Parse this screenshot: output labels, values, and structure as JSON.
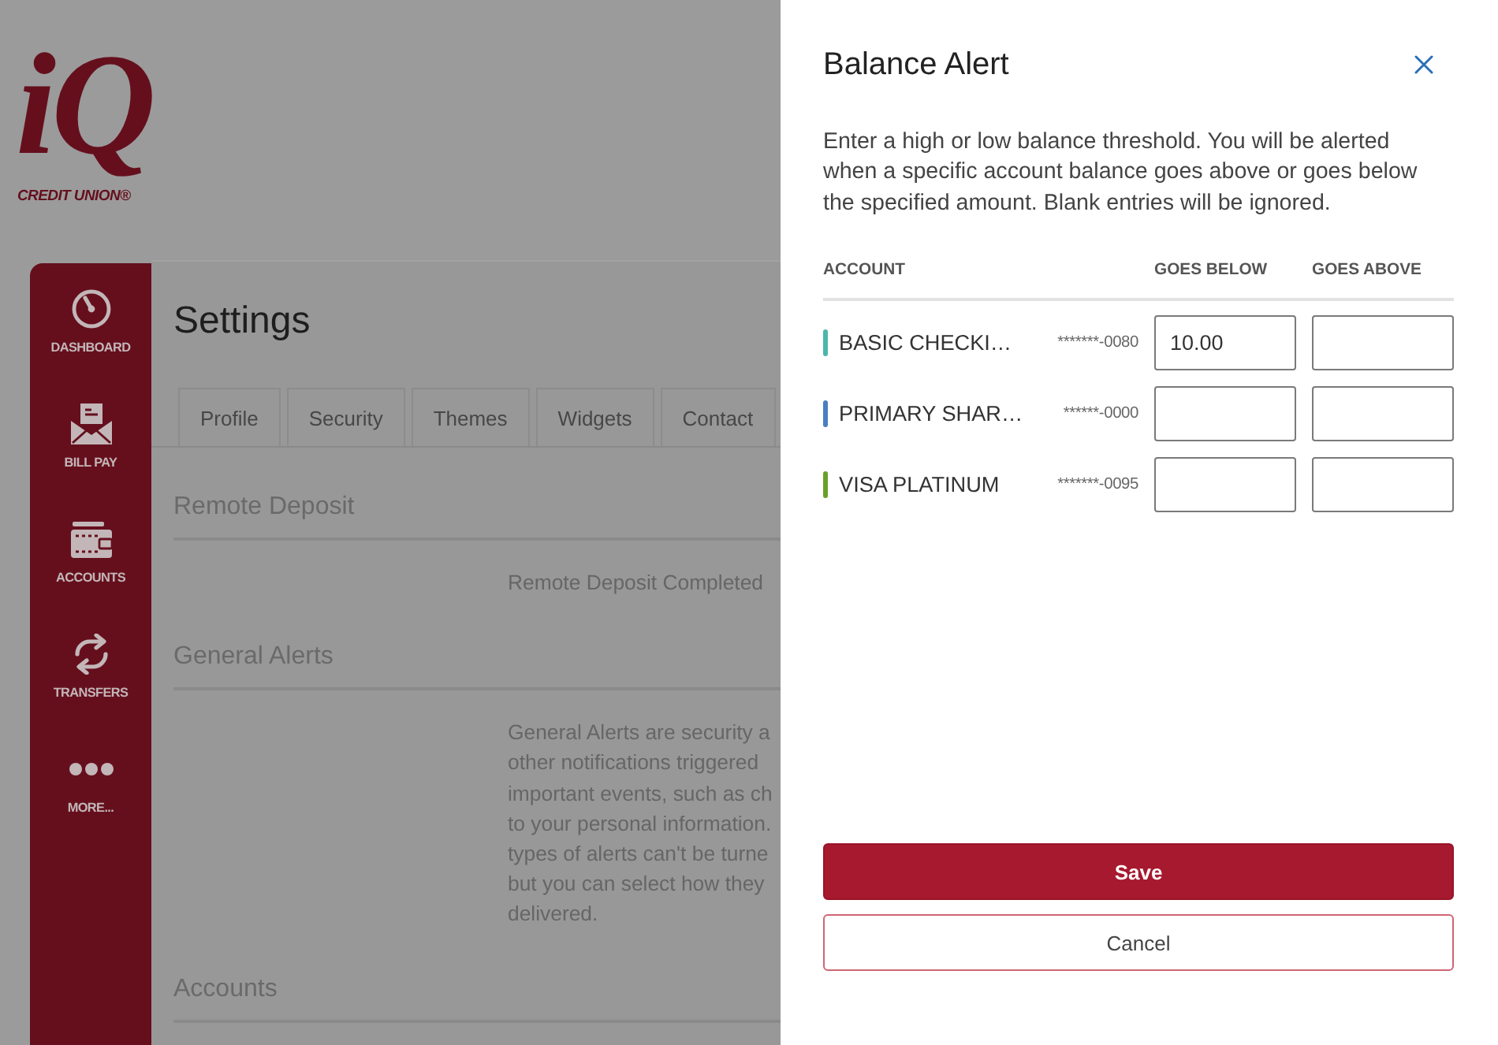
{
  "logo": {
    "mark": "iQ",
    "tagline": "CREDIT UNION®"
  },
  "sidebar": {
    "items": [
      {
        "kind": "dashboard",
        "label": "DASHBOARD"
      },
      {
        "kind": "billpay",
        "label": "BILL PAY"
      },
      {
        "kind": "accounts",
        "label": "ACCOUNTS"
      },
      {
        "kind": "transfers",
        "label": "TRANSFERS"
      },
      {
        "kind": "more",
        "label": "MORE..."
      }
    ]
  },
  "settings": {
    "title": "Settings",
    "tabs": [
      "Profile",
      "Security",
      "Themes",
      "Widgets",
      "Contact"
    ],
    "sections": [
      {
        "heading": "Remote Deposit",
        "lines": [
          "Remote Deposit Completed"
        ]
      },
      {
        "heading": "General Alerts",
        "lines": [
          "General Alerts are security a",
          "other notifications triggered",
          "important events, such as ch",
          "to your personal information.",
          "types of alerts can't be turne",
          "but you can select how they",
          "delivered."
        ]
      },
      {
        "heading": "Accounts"
      }
    ]
  },
  "dialog": {
    "title": "Balance Alert",
    "description": "Enter a high or low balance threshold. You will be alerted when a specific account balance goes above or goes below the specified amount. Blank entries will be ignored.",
    "columns": [
      "ACCOUNT",
      "GOES BELOW",
      "GOES ABOVE"
    ],
    "rows": [
      {
        "name": "BASIC CHECKI…",
        "number": "*******-0080",
        "color": "#4db6ac",
        "goes_below": "10.00"
      },
      {
        "name": "PRIMARY SHAR…",
        "number": "******-0000",
        "color": "#4a7fc1"
      },
      {
        "name": "VISA PLATINUM",
        "number": "*******-0095",
        "color": "#6aa029"
      }
    ],
    "buttons": [
      {
        "kind": "primary",
        "label": "Save"
      },
      {
        "kind": "secondary",
        "label": "Cancel"
      }
    ]
  }
}
